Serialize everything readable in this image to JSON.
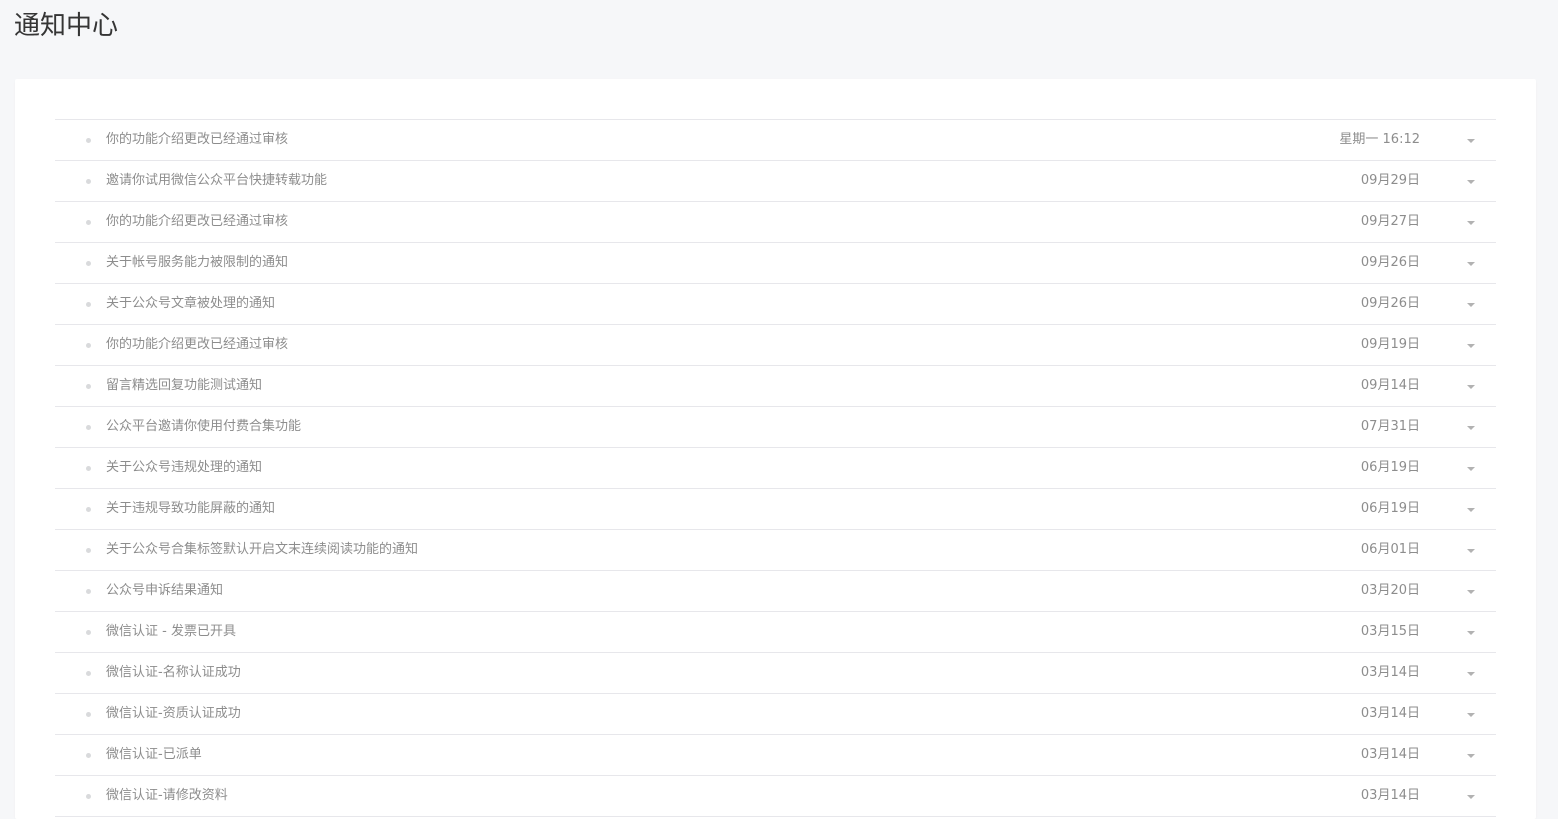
{
  "page": {
    "title": "通知中心"
  },
  "icons": {
    "bullet": "dot-icon",
    "expand": "caret-down-icon"
  },
  "colors": {
    "background": "#f6f7f9",
    "panel": "#ffffff",
    "text_muted": "#8d8d8d",
    "divider": "#e7e7eb"
  },
  "notices": [
    {
      "title": "你的功能介绍更改已经通过审核",
      "date": "星期一 16:12"
    },
    {
      "title": "邀请你试用微信公众平台快捷转载功能",
      "date": "09月29日"
    },
    {
      "title": "你的功能介绍更改已经通过审核",
      "date": "09月27日"
    },
    {
      "title": "关于帐号服务能力被限制的通知",
      "date": "09月26日"
    },
    {
      "title": "关于公众号文章被处理的通知",
      "date": "09月26日"
    },
    {
      "title": "你的功能介绍更改已经通过审核",
      "date": "09月19日"
    },
    {
      "title": "留言精选回复功能测试通知",
      "date": "09月14日"
    },
    {
      "title": "公众平台邀请你使用付费合集功能",
      "date": "07月31日"
    },
    {
      "title": "关于公众号违规处理的通知",
      "date": "06月19日"
    },
    {
      "title": "关于违规导致功能屏蔽的通知",
      "date": "06月19日"
    },
    {
      "title": "关于公众号合集标签默认开启文末连续阅读功能的通知",
      "date": "06月01日"
    },
    {
      "title": "公众号申诉结果通知",
      "date": "03月20日"
    },
    {
      "title": "微信认证 - 发票已开具",
      "date": "03月15日"
    },
    {
      "title": "微信认证-名称认证成功",
      "date": "03月14日"
    },
    {
      "title": "微信认证-资质认证成功",
      "date": "03月14日"
    },
    {
      "title": "微信认证-已派单",
      "date": "03月14日"
    },
    {
      "title": "微信认证-请修改资料",
      "date": "03月14日"
    }
  ]
}
